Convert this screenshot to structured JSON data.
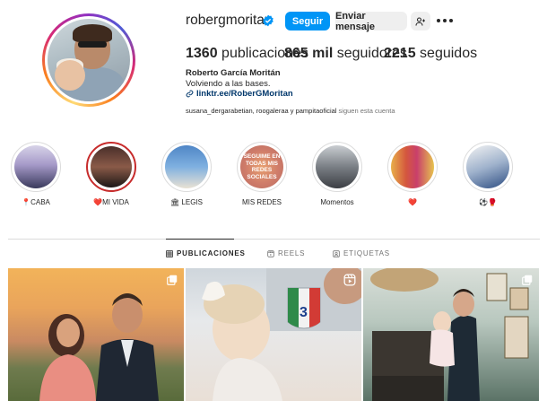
{
  "profile": {
    "username": "robergmoritan",
    "verified": true,
    "follow_label": "Seguir",
    "message_label": "Enviar mensaje",
    "stats": {
      "posts_count": "1360",
      "posts_label": "publicaciones",
      "followers_count": "865 mil",
      "followers_label": "seguidores",
      "following_count": "2215",
      "following_label": "seguidos"
    },
    "full_name": "Roberto García Moritán",
    "bio": "Volviendo a las bases.",
    "link": "linktr.ee/RoberGMoritan",
    "followed_by_names": "susana_dergarabetian, roogaleraa y pampitaoficial",
    "followed_by_suffix": "siguen esta cuenta"
  },
  "highlights": [
    {
      "label": "CABA",
      "prefix": "📍"
    },
    {
      "label": "MI VIDA",
      "prefix": "❤️"
    },
    {
      "label": "LEGIS",
      "prefix": "🏛"
    },
    {
      "label": "MIS REDES",
      "prefix": "",
      "cover_text": "SEGUIME EN TODAS MIS REDES SOCIALES"
    },
    {
      "label": "Momentos",
      "prefix": ""
    },
    {
      "label": "❤️",
      "prefix": ""
    },
    {
      "label": "⚽🥊",
      "prefix": ""
    }
  ],
  "tabs": [
    {
      "label": "PUBLICACIONES",
      "active": true
    },
    {
      "label": "REELS",
      "active": false
    },
    {
      "label": "ETIQUETAS",
      "active": false
    }
  ],
  "colors": {
    "primary_button": "#0095f6",
    "secondary_button": "#efefef",
    "link": "#00376b",
    "verified": "#0095f6"
  }
}
